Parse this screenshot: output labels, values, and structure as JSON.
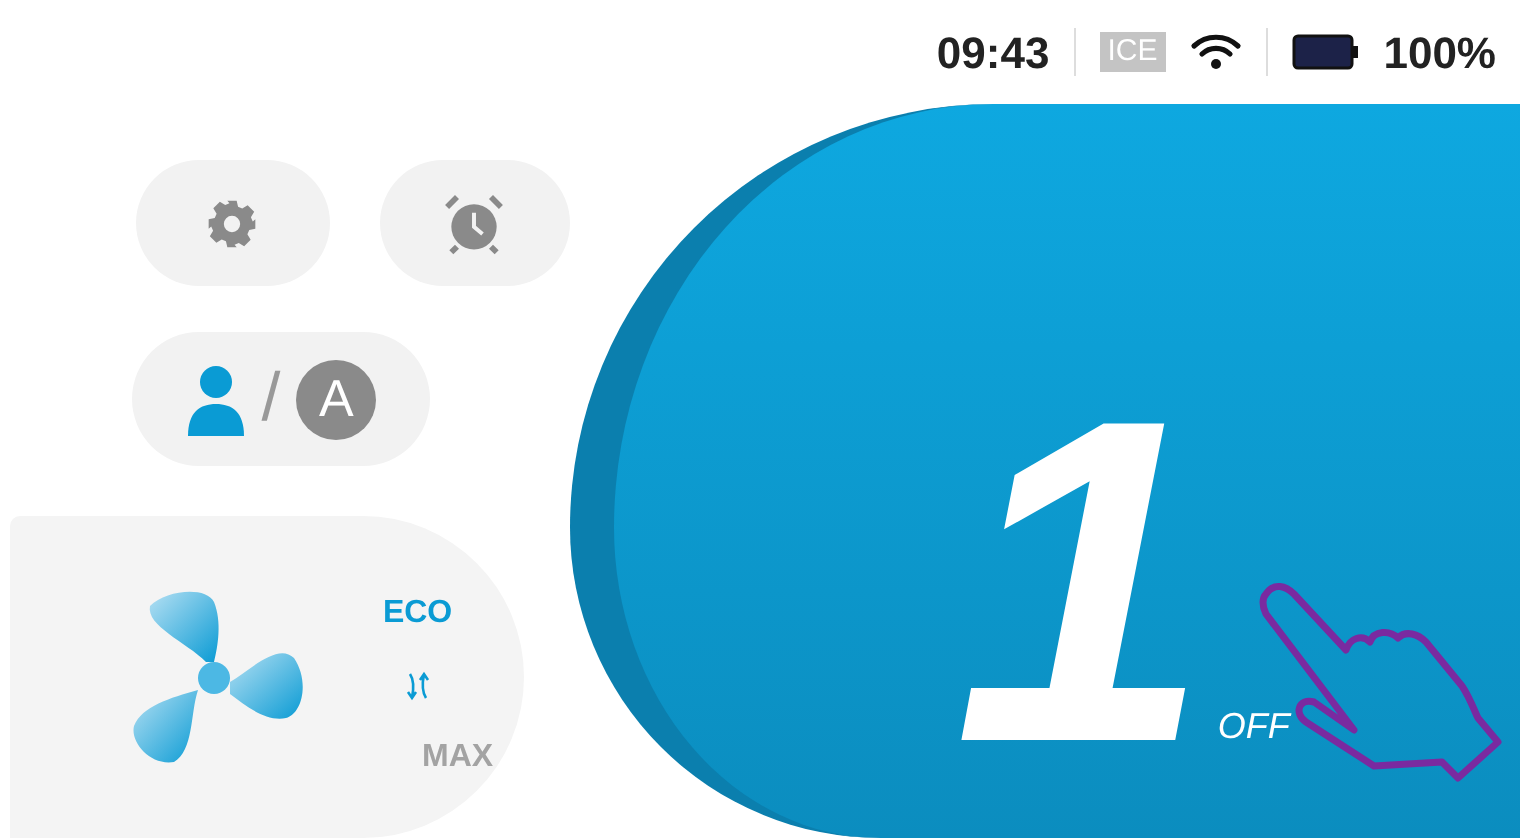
{
  "status_bar": {
    "time": "09:43",
    "network": "ICE",
    "battery": "100%"
  },
  "user_mode": {
    "separator": "/",
    "avatar_letter": "A"
  },
  "fan_modes": [
    {
      "label": "ECO",
      "selected": true
    },
    {
      "label": "MAX",
      "selected": false
    }
  ],
  "display": {
    "value": "1",
    "status": "OFF"
  }
}
